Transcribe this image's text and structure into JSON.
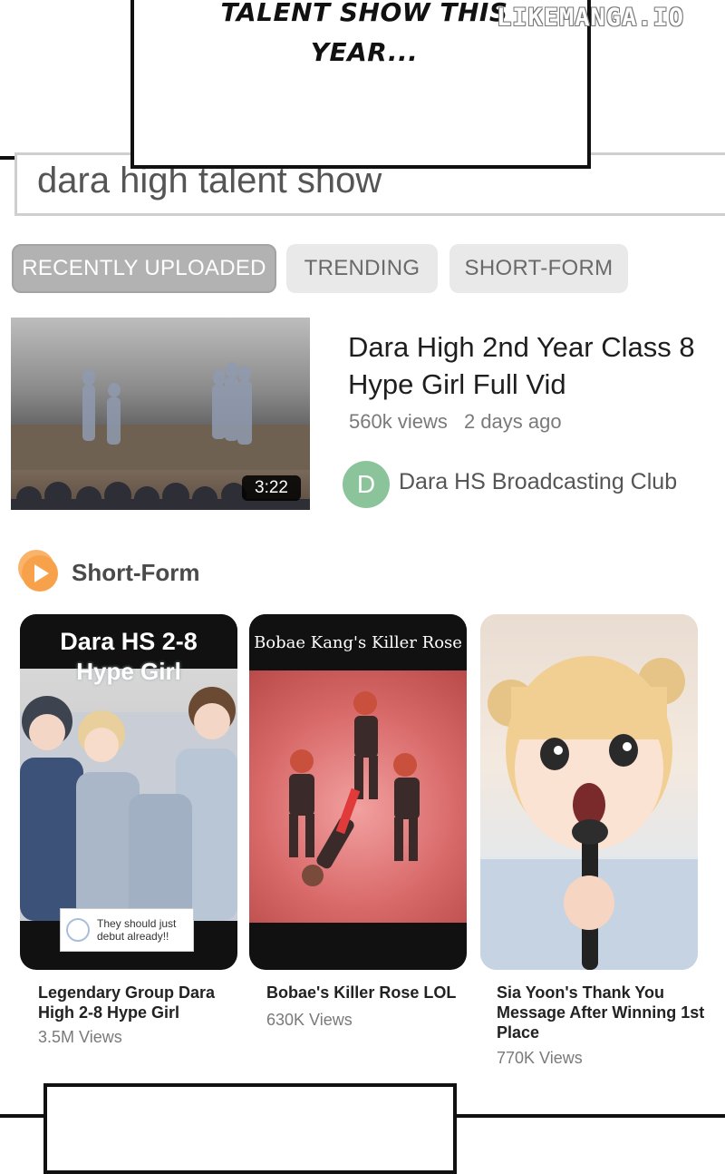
{
  "panel": {
    "speech_text": "TALENT SHOW THIS\nYEAR...",
    "watermark": "LIKEMANGA.IO"
  },
  "search": {
    "query": "dara high talent show"
  },
  "tabs": [
    {
      "label": "RECENTLY UPLOADED",
      "active": true
    },
    {
      "label": "TRENDING",
      "active": false
    },
    {
      "label": "SHORT-FORM",
      "active": false
    }
  ],
  "featured": {
    "title": "Dara High 2nd Year Class 8 Hype Girl Full Vid",
    "views": "560k views",
    "age": "2 days ago",
    "duration": "3:22",
    "channel_initial": "D",
    "channel": "Dara HS Broadcasting Club"
  },
  "short_form": {
    "heading": "Short-Form",
    "icon": "play-circle-icon",
    "accent": "#f7a24a",
    "cards": [
      {
        "header": "Dara HS 2-8",
        "subheader": "Hype Girl",
        "comment": "They should just debut already!!",
        "caption": "Legendary Group Dara High 2-8 Hype Girl",
        "views": "3.5M Views"
      },
      {
        "header": "Bobae Kang's Killer Rose",
        "caption": "Bobae's Killer Rose LOL",
        "views": "630K Views"
      },
      {
        "caption": "Sia Yoon's Thank You Message After Winning 1st Place",
        "views": "770K Views"
      }
    ]
  }
}
